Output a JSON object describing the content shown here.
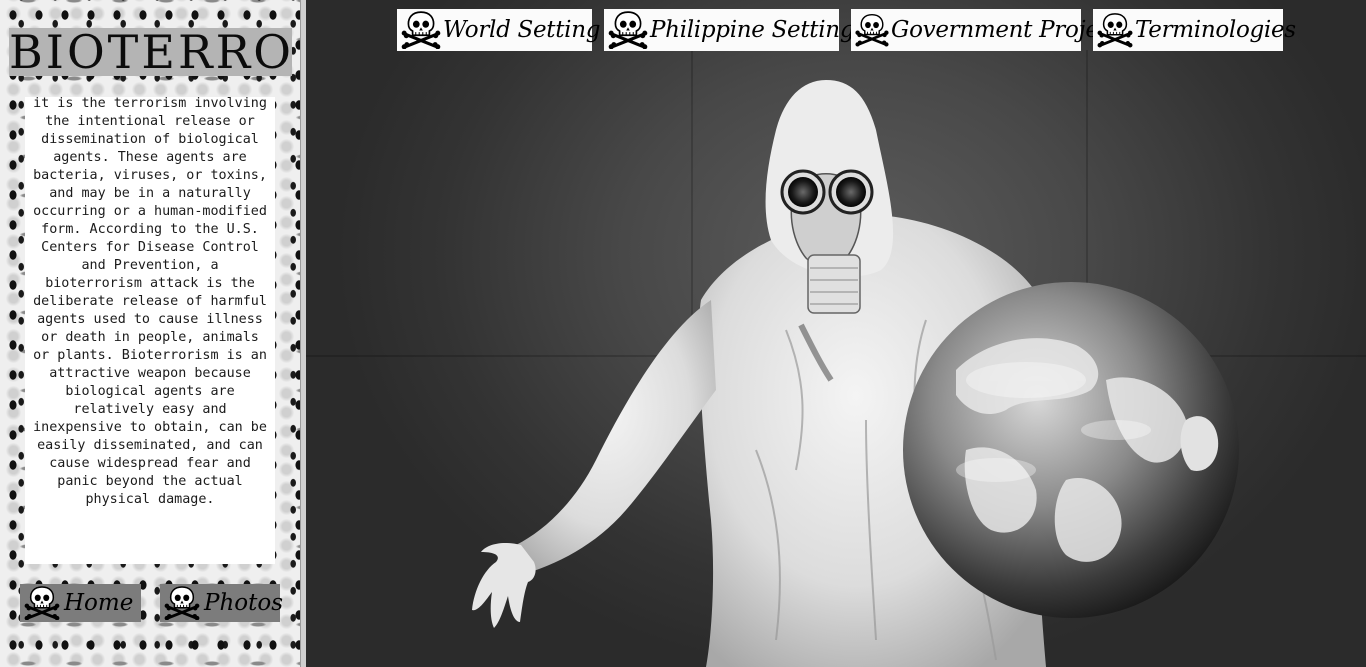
{
  "sidebar": {
    "brand": "BIOTERRORISM",
    "intro": "it is the terrorism involving the intentional release or dissemination of biological agents. These agents are bacteria, viruses, or toxins, and may be in a naturally occurring or a human-modified form. According to the U.S. Centers for Disease Control and Prevention, a bioterrorism attack is the deliberate release of harmful agents used to cause illness or death in people, animals or plants. Bioterrorism is an attractive weapon because biological agents are relatively easy and inexpensive to obtain, can be easily disseminated, and can cause widespread fear and panic beyond the actual physical damage.",
    "nav": [
      {
        "label": "Home",
        "icon": "skull-crossbones-icon"
      },
      {
        "label": "Photos",
        "icon": "skull-crossbones-icon"
      }
    ]
  },
  "top_nav": [
    {
      "label": "World Setting",
      "icon": "skull-crossbones-icon"
    },
    {
      "label": "Philippine Setting",
      "icon": "skull-crossbones-icon"
    },
    {
      "label": "Government Projects",
      "icon": "skull-crossbones-icon"
    },
    {
      "label": "Terminologies",
      "icon": "skull-crossbones-icon"
    }
  ],
  "hero": {
    "subject": "hazmat-suit-figure-holding-earth"
  },
  "colors": {
    "sidebar_bg": "#efefef",
    "brand_bg": "#b4b4b4",
    "side_btn_bg": "#7c7c7c",
    "top_btn_bg": "#fbfbfb",
    "main_bg": "#484848"
  }
}
